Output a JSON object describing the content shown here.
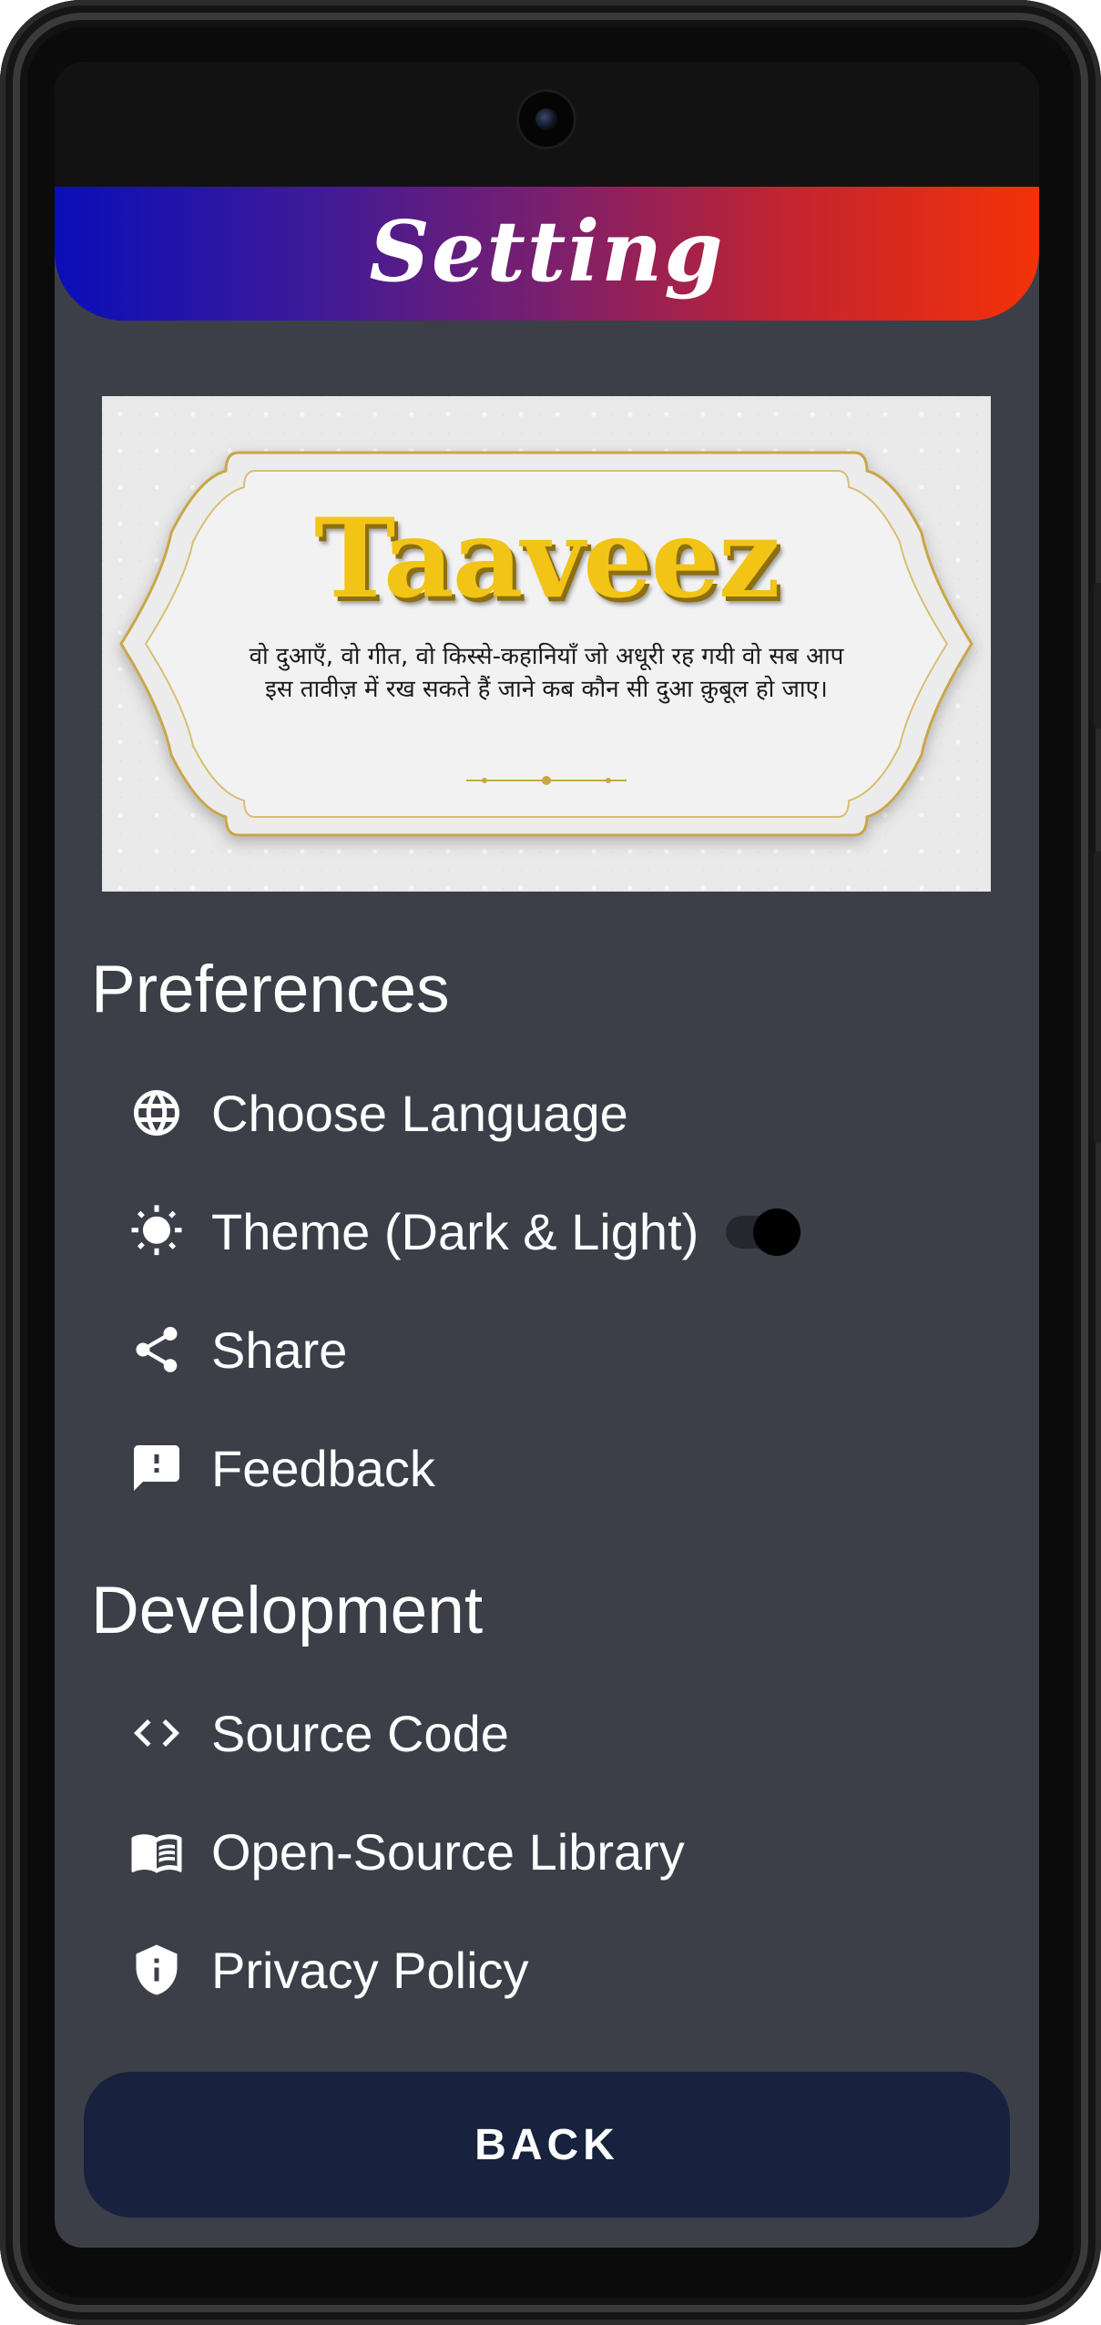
{
  "header": {
    "title": "Setting"
  },
  "banner": {
    "title": "Taaveez",
    "text": "वो दुआएँ, वो गीत, वो किस्से-कहानियाँ जो अधूरी रह गयी वो सब आप इस तावीज़ में रख सकते हैं जाने कब कौन सी दुआ क़ुबूल हो जाए।"
  },
  "preferences": {
    "title": "Preferences",
    "items": [
      {
        "label": "Choose Language",
        "icon": "globe-icon"
      },
      {
        "label": "Theme (Dark & Light)",
        "icon": "sun-icon",
        "toggle_on": true
      },
      {
        "label": "Share",
        "icon": "share-icon"
      },
      {
        "label": "Feedback",
        "icon": "feedback-icon"
      }
    ]
  },
  "development": {
    "title": "Development",
    "items": [
      {
        "label": "Source Code",
        "icon": "code-icon"
      },
      {
        "label": "Open-Source Library",
        "icon": "book-icon"
      },
      {
        "label": "Privacy Policy",
        "icon": "shield-info-icon"
      }
    ]
  },
  "back_button": {
    "label": "BACK"
  },
  "colors": {
    "background": "#3c3f48",
    "header_gradient_start": "#0a0eb8",
    "header_gradient_end": "#f43208",
    "button": "#18213d",
    "banner_title": "#f2c416"
  }
}
